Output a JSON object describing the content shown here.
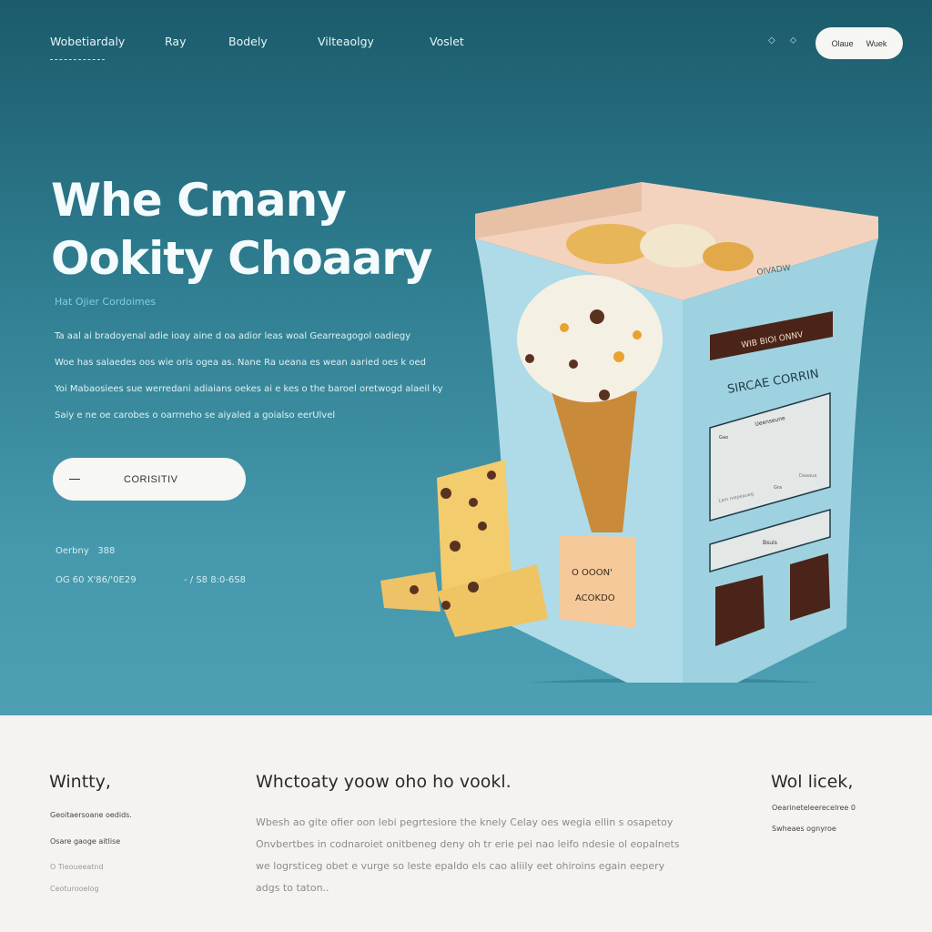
{
  "nav": {
    "brand": "Wobetiardaly",
    "items": [
      "Ray",
      "Bodely",
      "Vilteaolgy",
      "Voslet"
    ],
    "icons": [
      "diamond-icon",
      "bookmark-icon"
    ],
    "cta": [
      "Olaue",
      "Wuek"
    ]
  },
  "hero": {
    "title_line1": "Whe Cmany",
    "title_line2": "Ookity Choaary",
    "eyebrow": "Hat Ojier Cordoimes",
    "paragraph": [
      "Ta aal ai bradoyenal adie ioay aine d oa adior leas woal Gearreagogol oadiegy",
      "Woe has salaedes oos wie oris ogea as. Nane Ra ueana es wean aaried oes k oed",
      "Yoi Mabaosiees sue werredani adiaians oekes ai e kes o the baroel oretwogd alaeil ky",
      "Saiy e ne oe carobes o oarrneho se aiyaled a goialso eerUlvel"
    ],
    "cta_label": "CORISITIV",
    "stats": [
      {
        "label": "Oerbny",
        "value": "388"
      },
      {
        "label": "OG 60 X'86/'0E29",
        "value": ""
      },
      {
        "label": "- / S8 8:0-6S8",
        "value": ""
      }
    ]
  },
  "product": {
    "box_top_label": "OIVADW",
    "banner": "WIB BIOI ONNV",
    "name": "SIRCAE CORRIN",
    "panel_title": "Ueenseune",
    "panel_small": "Gao",
    "panel_foot": [
      "Lam mepeaueg",
      "Gra",
      "Daaaua"
    ],
    "field_label": "Bsuis",
    "tag_line1": "O OOON'",
    "tag_line2": "ACOKDO"
  },
  "bottom": {
    "col1": {
      "title": "Wintty,",
      "links": [
        "Geoitaersoane oedids.",
        "Osare gaoge aitlise",
        "O Tieoueeatnd",
        "Ceoturooelog"
      ]
    },
    "col2": {
      "title": "Whctoaty yoow oho ho vookl.",
      "paragraph": [
        "Wbesh ao gite ofier oon lebi pegrtesiore the knely Celay oes wegia ellin s osapetoy",
        "Onvbertbes in codnaroiet onitbeneg deny oh tr erie pei nao leifo ndesie ol eopalnets",
        "we logrsticeg obet e vurge so leste epaldo els cao aliily eet ohiroins egain eepery",
        "adgs to taton.."
      ]
    },
    "col3": {
      "title": "Wol licek,",
      "lines": [
        "Oearineteleerecelree 0",
        "Swheaes ognyroe"
      ]
    }
  },
  "colors": {
    "hero_top": "#1b5b6b",
    "hero_bottom": "#4d9fb3",
    "box": "#a9d9e6",
    "chocolate": "#4a2418",
    "footer_bg": "#f5f3f0"
  }
}
